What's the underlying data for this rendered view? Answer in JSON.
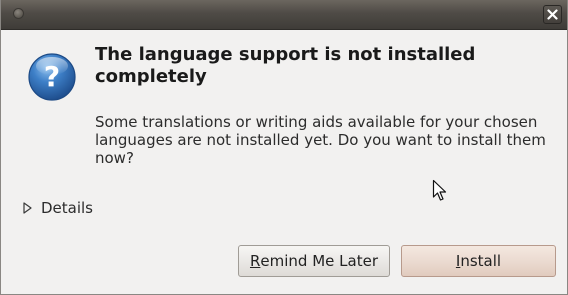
{
  "titlebar": {
    "menu_icon": "window-menu-icon",
    "close_icon": "close-icon"
  },
  "dialog": {
    "icon": "info-question-icon",
    "heading": "The language support is not installed completely",
    "body": "Some translations or writing aids available for your chosen languages are not installed yet. Do you want to install them now?",
    "details": {
      "icon": "expander-triangle-icon",
      "label": "Details"
    },
    "buttons": {
      "remind": {
        "mnemonic": "R",
        "rest": "emind Me Later"
      },
      "install": {
        "mnemonic": "I",
        "rest": "nstall"
      }
    }
  },
  "colors": {
    "titlebar": "#4f4b46",
    "background": "#f2f1f0",
    "icon_blue": "#2f6fb6"
  }
}
